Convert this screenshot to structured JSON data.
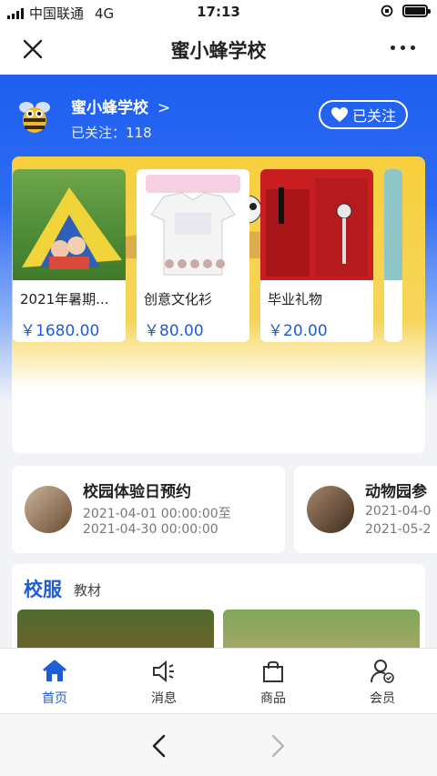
{
  "status_bar": {
    "carrier": "中国联通",
    "network": "4G",
    "time": "17:13"
  },
  "nav": {
    "title": "蜜小蜂学校",
    "close_icon": "close-icon",
    "more_icon": "more-icon"
  },
  "shop": {
    "name": "蜜小蜂学校",
    "name_chevron": ">",
    "fans": "已关注：118",
    "follow_label": "已关注"
  },
  "products": [
    {
      "name": "2021年暑期...",
      "price": "￥1680.00"
    },
    {
      "name": "创意文化衫",
      "price": "￥80.00"
    },
    {
      "name": "毕业礼物",
      "price": "￥20.00"
    }
  ],
  "events": [
    {
      "title": "校园体验日预约",
      "start": "2021-04-01 00:00:00至",
      "end": "2021-04-30 00:00:00"
    },
    {
      "title": "动物园参",
      "start": "2021-04-0",
      "end": "2021-05-2"
    }
  ],
  "section": {
    "title": "校服",
    "subtitle": "教材"
  },
  "tabs": [
    {
      "label": "首页",
      "icon": "home-icon",
      "active": true
    },
    {
      "label": "消息",
      "icon": "speaker-icon",
      "active": false
    },
    {
      "label": "商品",
      "icon": "bag-icon",
      "active": false
    },
    {
      "label": "会员",
      "icon": "member-icon",
      "active": false
    }
  ],
  "colors": {
    "primary": "#1f5cd6",
    "hero": "#1f5ff0",
    "banner": "#f7cf3c"
  }
}
